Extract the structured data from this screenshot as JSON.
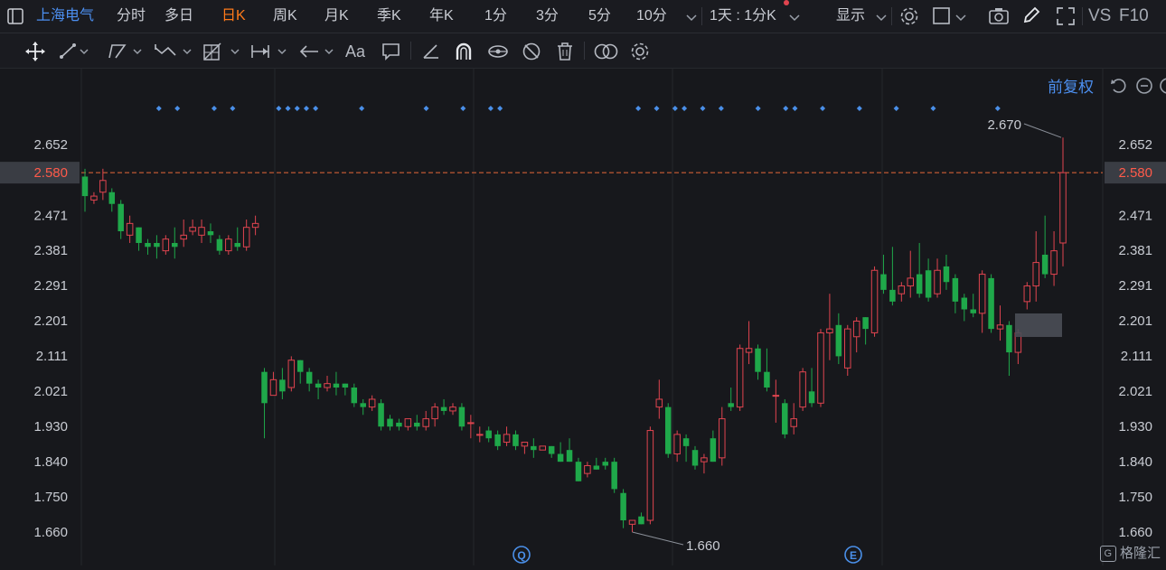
{
  "header": {
    "stock_name": "上海电气",
    "periods": [
      "分时",
      "多日",
      "日K",
      "周K",
      "月K",
      "季K",
      "年K",
      "1分",
      "3分",
      "5分",
      "10分"
    ],
    "active_period": "日K",
    "more_chevron": "⌄",
    "interval_label": "1天 : 1分K",
    "display_label": "显示",
    "vs_label": "VS",
    "f10_label": "F10"
  },
  "toolbar": {
    "icons": [
      "move-icon",
      "line-icon",
      "polyline-icon",
      "wave-icon",
      "grid-measure-icon",
      "range-icon",
      "arrow-icon",
      "text-icon",
      "comment-icon",
      "ruler-icon",
      "magnet-icon",
      "eye-link-icon",
      "hide-icon",
      "delete-icon",
      "overlay-icon",
      "settings-icon"
    ],
    "text_tool": "Aa"
  },
  "chart_header": {
    "adjust_label": "前复权"
  },
  "chart_data": {
    "type": "candlestick",
    "y_ticks": [
      "2.652",
      "2.580",
      "2.471",
      "2.381",
      "2.291",
      "2.201",
      "2.111",
      "2.021",
      "1.930",
      "1.840",
      "1.750",
      "1.660"
    ],
    "y_range": [
      1.64,
      2.72
    ],
    "current_price": "2.580",
    "max_label": "2.670",
    "min_label": "1.660",
    "colors": {
      "up": "#e0444f",
      "down": "#1fa84a",
      "price_line": "#e8693a",
      "marker": "#4a8fe8",
      "grid": "#25272c"
    },
    "markers": {
      "event_q": "Q",
      "event_e": "E"
    },
    "candles": [
      [
        2.57,
        2.52,
        2.59,
        2.48
      ],
      [
        2.51,
        2.52,
        2.53,
        2.5
      ],
      [
        2.53,
        2.56,
        2.59,
        2.51
      ],
      [
        2.53,
        2.5,
        2.54,
        2.48
      ],
      [
        2.5,
        2.43,
        2.51,
        2.41
      ],
      [
        2.42,
        2.45,
        2.47,
        2.4
      ],
      [
        2.44,
        2.4,
        2.44,
        2.38
      ],
      [
        2.4,
        2.39,
        2.41,
        2.37
      ],
      [
        2.4,
        2.39,
        2.42,
        2.36
      ],
      [
        2.38,
        2.41,
        2.42,
        2.37
      ],
      [
        2.4,
        2.39,
        2.44,
        2.36
      ],
      [
        2.41,
        2.42,
        2.46,
        2.39
      ],
      [
        2.43,
        2.44,
        2.46,
        2.42
      ],
      [
        2.42,
        2.44,
        2.46,
        2.4
      ],
      [
        2.43,
        2.42,
        2.45,
        2.4
      ],
      [
        2.41,
        2.38,
        2.42,
        2.37
      ],
      [
        2.38,
        2.41,
        2.42,
        2.37
      ],
      [
        2.4,
        2.39,
        2.44,
        2.38
      ],
      [
        2.39,
        2.44,
        2.46,
        2.38
      ],
      [
        2.44,
        2.45,
        2.47,
        2.42
      ],
      [
        2.07,
        1.99,
        2.08,
        1.9
      ],
      [
        2.01,
        2.05,
        2.07,
        2.01
      ],
      [
        2.05,
        2.02,
        2.08,
        2.0
      ],
      [
        2.03,
        2.1,
        2.11,
        2.02
      ],
      [
        2.1,
        2.07,
        2.1,
        2.04
      ],
      [
        2.07,
        2.04,
        2.08,
        2.02
      ],
      [
        2.04,
        2.03,
        2.05,
        2.0
      ],
      [
        2.03,
        2.04,
        2.06,
        2.02
      ],
      [
        2.04,
        2.03,
        2.07,
        2.01
      ],
      [
        2.04,
        2.03,
        2.04,
        2.01
      ],
      [
        2.03,
        1.99,
        2.04,
        1.98
      ],
      [
        1.99,
        1.98,
        2.0,
        1.96
      ],
      [
        1.98,
        2.0,
        2.01,
        1.97
      ],
      [
        1.99,
        1.93,
        2.0,
        1.92
      ],
      [
        1.95,
        1.93,
        1.96,
        1.92
      ],
      [
        1.94,
        1.93,
        1.95,
        1.92
      ],
      [
        1.93,
        1.95,
        1.95,
        1.92
      ],
      [
        1.94,
        1.93,
        1.96,
        1.92
      ],
      [
        1.93,
        1.95,
        1.97,
        1.92
      ],
      [
        1.95,
        1.98,
        1.99,
        1.93
      ],
      [
        1.98,
        1.97,
        2.0,
        1.96
      ],
      [
        1.97,
        1.98,
        1.99,
        1.96
      ],
      [
        1.98,
        1.93,
        1.99,
        1.92
      ],
      [
        1.94,
        1.94,
        1.96,
        1.9
      ],
      [
        1.91,
        1.91,
        1.93,
        1.89
      ],
      [
        1.92,
        1.9,
        1.93,
        1.89
      ],
      [
        1.91,
        1.88,
        1.92,
        1.87
      ],
      [
        1.89,
        1.91,
        1.93,
        1.88
      ],
      [
        1.91,
        1.88,
        1.92,
        1.87
      ],
      [
        1.88,
        1.89,
        1.89,
        1.86
      ],
      [
        1.88,
        1.87,
        1.9,
        1.85
      ],
      [
        1.87,
        1.88,
        1.88,
        1.87
      ],
      [
        1.88,
        1.86,
        1.88,
        1.85
      ],
      [
        1.86,
        1.84,
        1.89,
        1.84
      ],
      [
        1.87,
        1.84,
        1.9,
        1.84
      ],
      [
        1.84,
        1.79,
        1.85,
        1.79
      ],
      [
        1.81,
        1.83,
        1.84,
        1.8
      ],
      [
        1.83,
        1.82,
        1.85,
        1.82
      ],
      [
        1.84,
        1.83,
        1.85,
        1.82
      ],
      [
        1.84,
        1.77,
        1.85,
        1.76
      ],
      [
        1.76,
        1.69,
        1.77,
        1.67
      ],
      [
        1.68,
        1.69,
        1.69,
        1.66
      ],
      [
        1.7,
        1.68,
        1.71,
        1.68
      ],
      [
        1.69,
        1.92,
        1.93,
        1.68
      ],
      [
        1.98,
        2.0,
        2.05,
        1.95
      ],
      [
        1.98,
        1.86,
        1.99,
        1.85
      ],
      [
        1.86,
        1.91,
        1.92,
        1.84
      ],
      [
        1.9,
        1.88,
        1.91,
        1.84
      ],
      [
        1.87,
        1.83,
        1.88,
        1.82
      ],
      [
        1.84,
        1.85,
        1.86,
        1.81
      ],
      [
        1.9,
        1.84,
        1.92,
        1.84
      ],
      [
        1.85,
        1.95,
        1.98,
        1.83
      ],
      [
        1.99,
        1.98,
        2.03,
        1.97
      ],
      [
        1.98,
        2.13,
        2.14,
        1.97
      ],
      [
        2.12,
        2.13,
        2.2,
        2.09
      ],
      [
        2.13,
        2.07,
        2.14,
        2.05
      ],
      [
        2.07,
        2.03,
        2.13,
        2.02
      ],
      [
        2.01,
        2.01,
        2.05,
        1.94
      ],
      [
        1.99,
        1.91,
        2.0,
        1.9
      ],
      [
        1.93,
        1.95,
        1.99,
        1.91
      ],
      [
        1.98,
        2.07,
        2.08,
        1.97
      ],
      [
        2.02,
        1.99,
        2.08,
        1.98
      ],
      [
        1.99,
        2.17,
        2.18,
        1.98
      ],
      [
        2.17,
        2.18,
        2.27,
        2.1
      ],
      [
        2.19,
        2.11,
        2.22,
        2.09
      ],
      [
        2.08,
        2.18,
        2.19,
        2.06
      ],
      [
        2.16,
        2.2,
        2.21,
        2.12
      ],
      [
        2.21,
        2.18,
        2.21,
        2.14
      ],
      [
        2.17,
        2.33,
        2.34,
        2.16
      ],
      [
        2.32,
        2.28,
        2.37,
        2.27
      ],
      [
        2.28,
        2.25,
        2.39,
        2.24
      ],
      [
        2.27,
        2.29,
        2.3,
        2.25
      ],
      [
        2.29,
        2.31,
        2.38,
        2.26
      ],
      [
        2.32,
        2.27,
        2.4,
        2.26
      ],
      [
        2.33,
        2.26,
        2.36,
        2.25
      ],
      [
        2.27,
        2.33,
        2.36,
        2.26
      ],
      [
        2.34,
        2.3,
        2.37,
        2.28
      ],
      [
        2.31,
        2.25,
        2.32,
        2.22
      ],
      [
        2.26,
        2.23,
        2.27,
        2.2
      ],
      [
        2.23,
        2.22,
        2.27,
        2.21
      ],
      [
        2.22,
        2.32,
        2.33,
        2.17
      ],
      [
        2.31,
        2.18,
        2.32,
        2.17
      ],
      [
        2.18,
        2.19,
        2.24,
        2.15
      ],
      [
        2.19,
        2.12,
        2.2,
        2.06
      ],
      [
        2.12,
        2.17,
        2.18,
        2.09
      ],
      [
        2.25,
        2.29,
        2.3,
        2.23
      ],
      [
        2.29,
        2.35,
        2.43,
        2.25
      ],
      [
        2.37,
        2.32,
        2.47,
        2.31
      ],
      [
        2.32,
        2.38,
        2.43,
        2.29
      ],
      [
        2.4,
        2.58,
        2.67,
        2.34
      ]
    ],
    "event_dots": [
      4,
      6,
      10,
      12,
      17,
      18,
      19,
      20,
      21,
      26,
      33,
      37,
      40,
      41,
      56,
      58,
      60,
      61,
      63,
      65,
      69,
      72,
      73,
      76,
      80,
      84,
      88,
      95
    ]
  },
  "watermark": "格隆汇"
}
